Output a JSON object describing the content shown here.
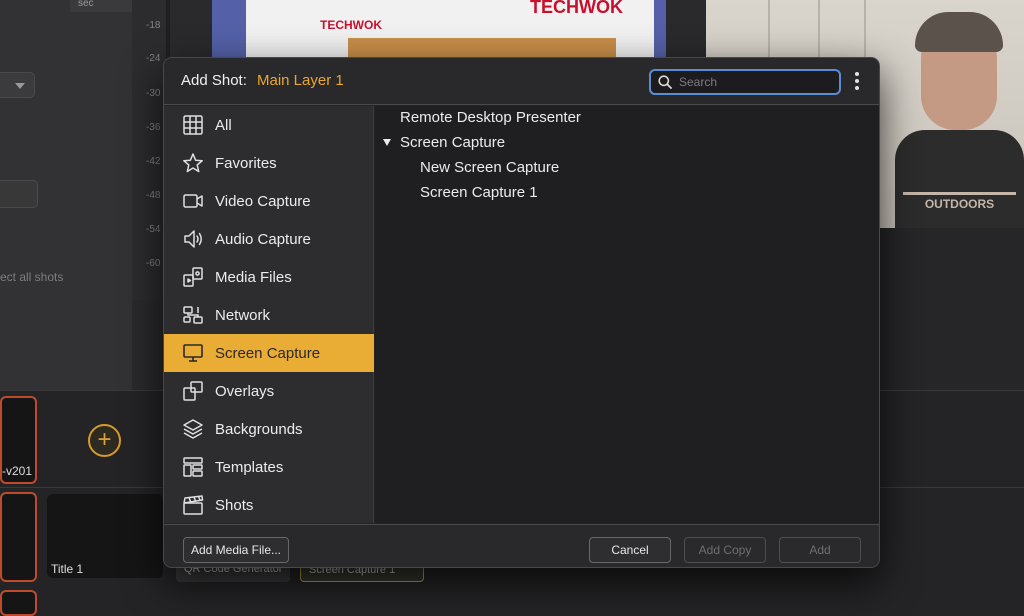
{
  "background": {
    "sec_label": "sec",
    "meter_ticks": [
      "-18",
      "-24",
      "-30",
      "-36",
      "-42",
      "-48",
      "-54",
      "-60"
    ],
    "hint_text": "ect all shots",
    "preview_logo": "TECHWOK",
    "webcam_shirt_text": "OUTDOORS",
    "thumb_labels": {
      "left_top": "-v201",
      "title": "Title 1"
    },
    "chips": {
      "qr": "QR Code Generator",
      "screen": "Screen Capture 1"
    },
    "add_symbol": "+"
  },
  "dialog": {
    "title": "Add Shot:",
    "layer": "Main Layer 1",
    "search_placeholder": "Search",
    "categories": [
      {
        "label": "All",
        "icon": "grid-icon"
      },
      {
        "label": "Favorites",
        "icon": "star-icon"
      },
      {
        "label": "Video Capture",
        "icon": "video-camera-icon"
      },
      {
        "label": "Audio Capture",
        "icon": "speaker-icon"
      },
      {
        "label": "Media Files",
        "icon": "media-files-icon"
      },
      {
        "label": "Network",
        "icon": "network-icon"
      },
      {
        "label": "Screen Capture",
        "icon": "monitor-icon",
        "selected": true
      },
      {
        "label": "Overlays",
        "icon": "overlays-icon"
      },
      {
        "label": "Backgrounds",
        "icon": "layers-icon"
      },
      {
        "label": "Templates",
        "icon": "template-icon"
      },
      {
        "label": "Shots",
        "icon": "clapperboard-icon"
      }
    ],
    "tree": {
      "remote": "Remote Desktop Presenter",
      "screen_capture": "Screen Capture",
      "new_screen_capture": "New Screen Capture",
      "screen_capture_1": "Screen Capture 1"
    },
    "footer": {
      "add_media": "Add Media File...",
      "cancel": "Cancel",
      "add_copy": "Add Copy",
      "add": "Add"
    },
    "colors": {
      "accent": "#e9ac34",
      "search_border": "#5b8cd8"
    }
  }
}
